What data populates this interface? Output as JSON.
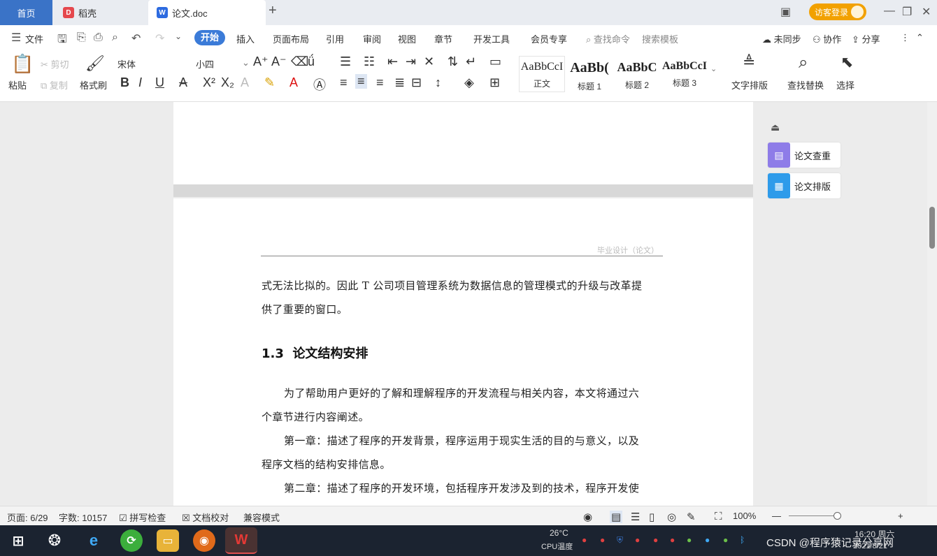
{
  "tabs": {
    "home": "首页",
    "docer": "稻壳",
    "doc": "论文.doc",
    "new_tab": "+",
    "login": "访客登录"
  },
  "menu": {
    "file": "文件",
    "items": [
      "开始",
      "插入",
      "页面布局",
      "引用",
      "审阅",
      "视图",
      "章节",
      "开发工具",
      "会员专享"
    ],
    "search_cmd": "查找命令",
    "search_template": "搜索模板",
    "sync": "未同步",
    "collab": "协作",
    "share": "分享"
  },
  "ribbon": {
    "paste": "粘贴",
    "cut": "剪切",
    "copy": "复制",
    "format_painter": "格式刷",
    "font_name": "宋体",
    "font_size": "小四",
    "styles": [
      {
        "sample": "AaBbCcI",
        "label": "正文"
      },
      {
        "sample": "AaBb(",
        "label": "标题 1"
      },
      {
        "sample": "AaBbC",
        "label": "标题 2"
      },
      {
        "sample": "AaBbCcI",
        "label": "标题 3"
      }
    ],
    "text_layout": "文字排版",
    "find_replace": "查找替换",
    "select": "选择"
  },
  "document": {
    "header_text": "毕业设计（论文）",
    "lines": [
      "式无法比拟的。因此 T 公司项目管理系统为数据信息的管理模式的升级与改革提",
      "供了重要的窗口。",
      "为了帮助用户更好的了解和理解程序的开发流程与相关内容，本文将通过六",
      "个章节进行内容阐述。",
      "第一章：描述了程序的开发背景，程序运用于现实生活的目的与意义，以及",
      "程序文档的结构安排信息。",
      "第二章：描述了程序的开发环境，包括程序开发涉及到的技术，程序开发使"
    ],
    "heading_num": "1.3",
    "heading_text": "论文结构安排"
  },
  "side_panel": {
    "check": "论文查重",
    "format": "论文排版"
  },
  "status": {
    "page": "页面: 6/29",
    "words": "字数: 10157",
    "spell": "拼写检查",
    "proof": "文档校对",
    "compat": "兼容模式",
    "zoom": "100%"
  },
  "taskbar": {
    "weather": "26°C",
    "weather_sub": "CPU温度",
    "watermark": "CSDN @程序猿记录分享网",
    "time": "16:20 周六",
    "date": "2021/8/21"
  },
  "colors": {
    "accent": "#3b7bd8",
    "tab_home": "#3a73c7",
    "login": "#f2a100",
    "taskbar": "#1b2330"
  }
}
